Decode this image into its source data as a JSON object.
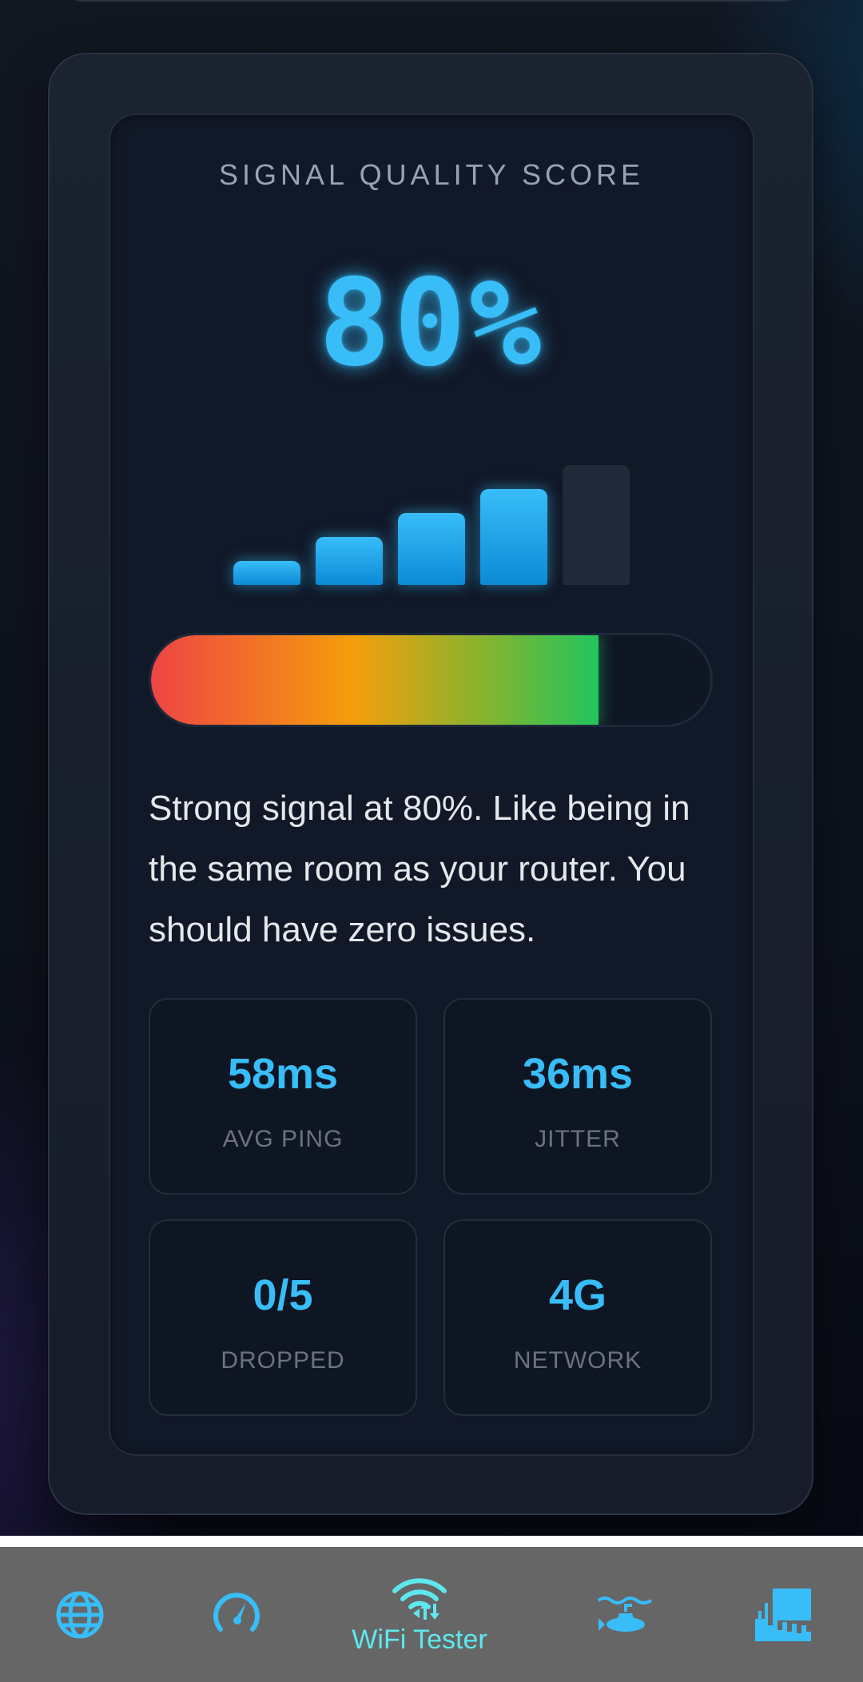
{
  "score": {
    "title": "SIGNAL QUALITY SCORE",
    "value_text": "80%",
    "signal_bars_active": 4,
    "signal_bars_total": 5,
    "quality_fraction": 0.8
  },
  "description": "Strong signal at 80%. Like being in the same room as your router. You should have zero issues.",
  "stats": [
    {
      "value": "58ms",
      "label": "AVG PING"
    },
    {
      "value": "36ms",
      "label": "JITTER"
    },
    {
      "value": "0/5",
      "label": "DROPPED"
    },
    {
      "value": "4G",
      "label": "NETWORK"
    }
  ],
  "colors": {
    "accent": "#38bdf8",
    "nav_label": "#5ee8ee",
    "nav_background": "#666666",
    "gradient": [
      "#ef4444",
      "#f59e0b",
      "#22c55e"
    ]
  },
  "nav": {
    "items": [
      {
        "icon": "globe-icon"
      },
      {
        "icon": "speedometer-icon"
      },
      {
        "icon": "wifi-transfer-icon",
        "label": "WiFi Tester",
        "active": true
      },
      {
        "icon": "submarine-icon"
      },
      {
        "icon": "city-chart-icon"
      }
    ]
  }
}
